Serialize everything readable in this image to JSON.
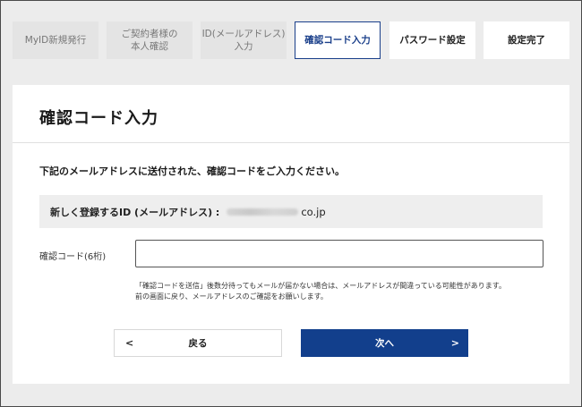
{
  "steps": [
    {
      "label": "MyID新規発行",
      "state": "done"
    },
    {
      "label": "ご契約者様の\n本人確認",
      "state": "done"
    },
    {
      "label": "ID(メールアドレス)\n入力",
      "state": "done"
    },
    {
      "label": "確認コード入力",
      "state": "active"
    },
    {
      "label": "パスワード設定",
      "state": "future"
    },
    {
      "label": "設定完了",
      "state": "future"
    }
  ],
  "card": {
    "title": "確認コード入力",
    "instruction": "下記のメールアドレスに送付された、確認コードをご入力ください。",
    "id_label": "新しく登録するID (メールアドレス) :",
    "id_domain": "co.jp",
    "code_label": "確認コード(6桁)",
    "code_value": "",
    "note_line1": "「確認コードを送信」後数分待ってもメールが届かない場合は、メールアドレスが間違っている可能性があります。",
    "note_line2": "前の画面に戻り、メールアドレスのご確認をお願いします。",
    "back_label": "戻る",
    "back_arrow": "<",
    "next_label": "次へ",
    "next_arrow": ">"
  },
  "colors": {
    "accent": "#123f8c",
    "step_inactive_bg": "#e4e4e4",
    "page_bg": "#ececec"
  }
}
